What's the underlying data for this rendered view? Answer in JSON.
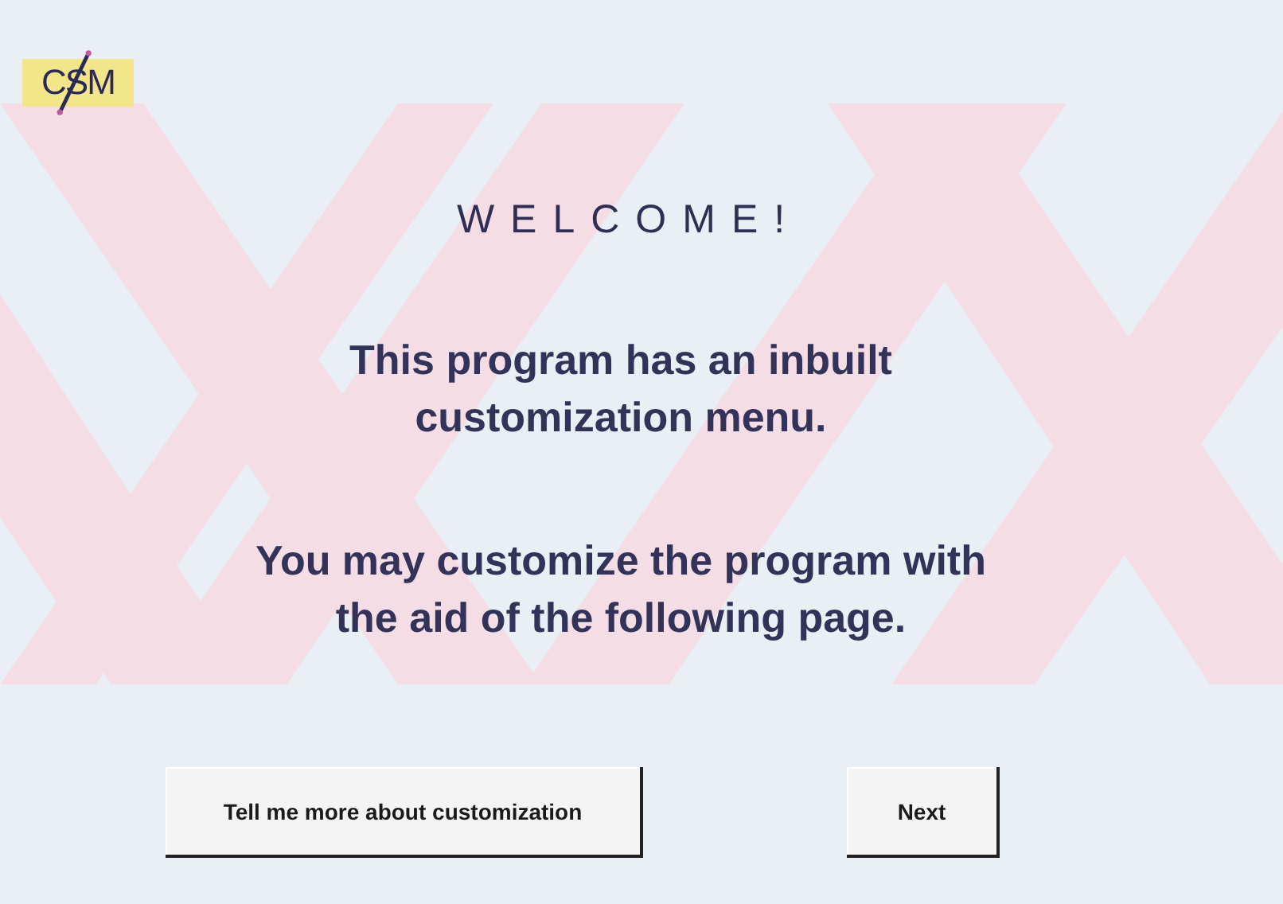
{
  "logo": {
    "text": "CSM"
  },
  "title": "WELCOME!",
  "paragraphs": [
    "This program has an inbuilt customization menu.",
    "You may customize the program with the aid of the following page."
  ],
  "buttons": [
    {
      "label": "Tell me more about customization"
    },
    {
      "label": "Next"
    }
  ]
}
